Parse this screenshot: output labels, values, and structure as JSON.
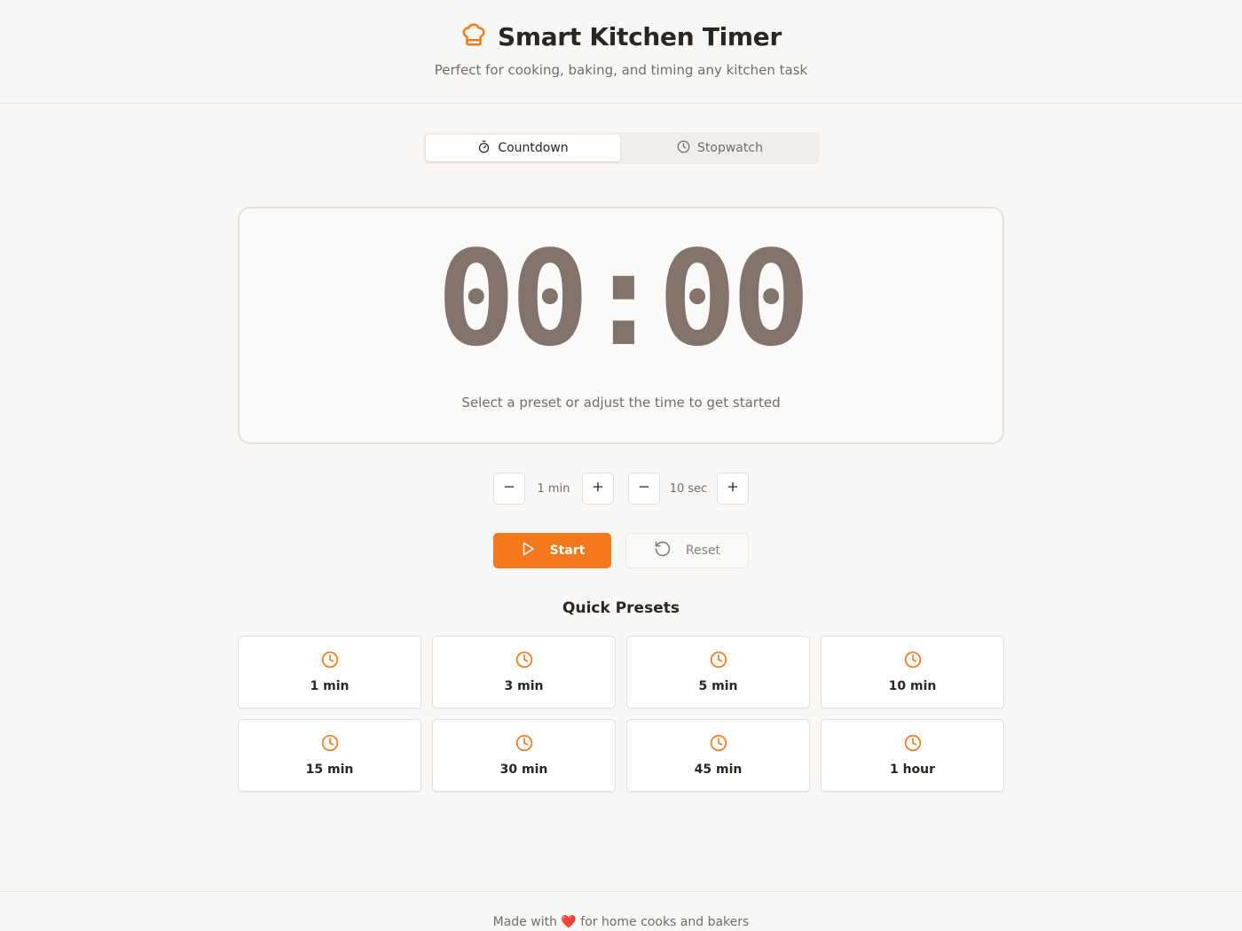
{
  "header": {
    "title": "Smart Kitchen Timer",
    "subtitle": "Perfect for cooking, baking, and timing any kitchen task",
    "logo_icon": "chef-hat-icon"
  },
  "mode_toggle": {
    "selected": "Countdown",
    "tabs": [
      {
        "label": "Countdown",
        "icon": "timer-icon"
      },
      {
        "label": "Stopwatch",
        "icon": "clock-icon"
      }
    ]
  },
  "timer": {
    "display": "00:00",
    "hint": "Select a preset or adjust the time to get started"
  },
  "adjust": {
    "minutes_label": "1 min",
    "seconds_label": "10 sec"
  },
  "actions": {
    "start_label": "Start",
    "reset_label": "Reset"
  },
  "presets": {
    "title": "Quick Presets",
    "items": [
      {
        "label": "1 min"
      },
      {
        "label": "3 min"
      },
      {
        "label": "5 min"
      },
      {
        "label": "10 min"
      },
      {
        "label": "15 min"
      },
      {
        "label": "30 min"
      },
      {
        "label": "45 min"
      },
      {
        "label": "1 hour"
      }
    ]
  },
  "footer": {
    "text": "Made with ❤️ for home cooks and bakers"
  },
  "colors": {
    "accent": "#f6781c",
    "timer_digits": "#82746c",
    "background": "#faf8f6"
  }
}
